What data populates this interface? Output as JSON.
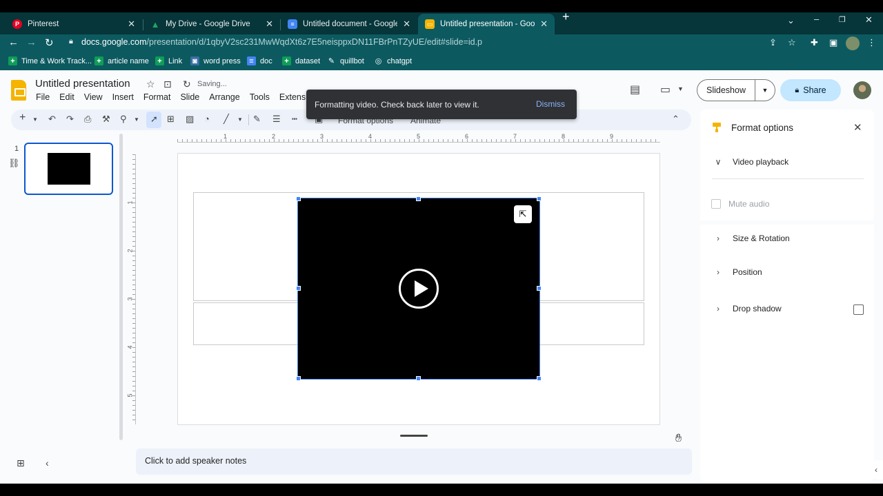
{
  "browser": {
    "tabs": [
      {
        "title": "Pinterest",
        "fav_color": "#e60023",
        "fav_glyph": "P"
      },
      {
        "title": "My Drive - Google Drive",
        "fav_color": "#1fa463",
        "fav_glyph": "▲"
      },
      {
        "title": "Untitled document - Google Doc",
        "fav_color": "#4285f4",
        "fav_glyph": "≡"
      },
      {
        "title": "Untitled presentation - Google Sl",
        "fav_color": "#f4b400",
        "fav_glyph": "▭"
      }
    ],
    "url_host": "docs.google.com",
    "url_path": "/presentation/d/1qbyV2sc231MwWqdXt6z7E5neisppxDN11FBrPnTZyUE/edit#slide=id.p",
    "bookmarks": [
      {
        "label": "Time & Work Track...",
        "color": "#0f9d58",
        "glyph": "+"
      },
      {
        "label": "article name",
        "color": "#0f9d58",
        "glyph": "+"
      },
      {
        "label": "Link",
        "color": "#0f9d58",
        "glyph": "+"
      },
      {
        "label": "word press",
        "color": "#3b6ea5",
        "glyph": "◙"
      },
      {
        "label": "doc",
        "color": "#4285f4",
        "glyph": "≡"
      },
      {
        "label": "dataset",
        "color": "#0f9d58",
        "glyph": "+"
      },
      {
        "label": "quillbot",
        "color": "#0c5a60",
        "glyph": "✎"
      },
      {
        "label": "chatgpt",
        "color": "#0c5a60",
        "glyph": "◎"
      }
    ]
  },
  "app": {
    "title": "Untitled presentation",
    "status": "Saving...",
    "menu": [
      "File",
      "Edit",
      "View",
      "Insert",
      "Format",
      "Slide",
      "Arrange",
      "Tools",
      "Extension"
    ],
    "slideshow_label": "Slideshow",
    "share_label": "Share",
    "toolbar": {
      "format_options_label": "Format options",
      "animate_label": "Animate"
    },
    "toast": {
      "message": "Formatting video. Check back later to view it.",
      "action": "Dismiss"
    },
    "slide_number": "1",
    "ruler_h": [
      "1",
      "2",
      "3",
      "4",
      "5",
      "6",
      "7",
      "8",
      "9"
    ],
    "ruler_v": [
      "1",
      "2",
      "3",
      "4",
      "5"
    ],
    "speaker_notes_placeholder": "Click to add speaker notes"
  },
  "panel": {
    "title": "Format options",
    "video_playback": "Video playback",
    "mute_audio": "Mute audio",
    "size_rotation": "Size & Rotation",
    "position": "Position",
    "drop_shadow": "Drop shadow"
  },
  "colors": {
    "chrome_dark": "#06353a",
    "chrome": "#0c5a60",
    "accent": "#0b57d0",
    "share_bg": "#c2e7ff",
    "selection": "#4285f4"
  }
}
